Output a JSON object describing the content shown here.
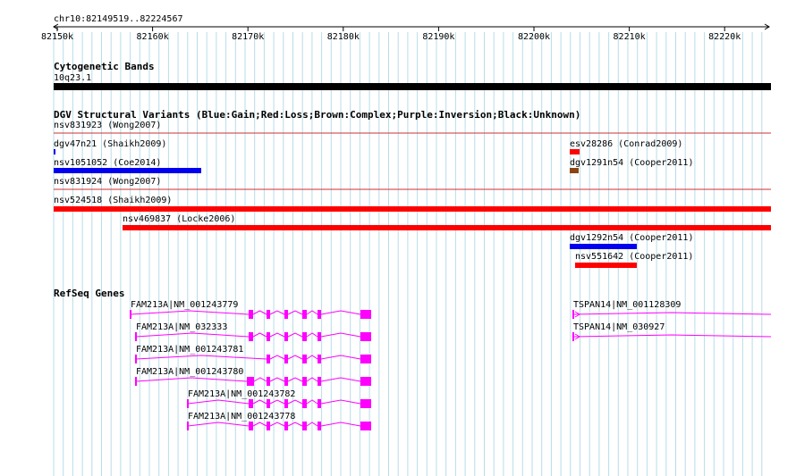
{
  "colors": {
    "grid": "#b8dcea",
    "gain": "#0000ee",
    "loss": "#ff0000",
    "complex": "#8b4513",
    "gene": "#ff00ff",
    "divider": "#cc3333",
    "ideogram": "#000000"
  },
  "ruler": {
    "label": "chr10:82149519..82224567",
    "ticks": [
      "82150k",
      "82160k",
      "82170k",
      "82180k",
      "82190k",
      "82200k",
      "82210k",
      "82220k"
    ],
    "arrow_icon": "double-arrow-icon"
  },
  "cytoband": {
    "title": "Cytogenetic Bands",
    "band": "10q23.1"
  },
  "dgv": {
    "title": "DGV Structural Variants (Blue:Gain;Red:Loss;Brown:Complex;Purple:Inversion;Black:Unknown)",
    "features": [
      {
        "label": "nsv831923 (Wong2007)"
      },
      {
        "label": "dgv47n21 (Shaikh2009)"
      },
      {
        "label": "nsv1051052 (Coe2014)"
      },
      {
        "label": "nsv831924 (Wong2007)"
      },
      {
        "label": "esv28286 (Conrad2009)"
      },
      {
        "label": "dgv1291n54 (Cooper2011)"
      },
      {
        "label": "nsv524518 (Shaikh2009)"
      },
      {
        "label": "nsv469837 (Locke2006)"
      },
      {
        "label": "dgv1292n54 (Cooper2011)"
      },
      {
        "label": "nsv551642 (Cooper2011)"
      }
    ]
  },
  "refseq": {
    "title": "RefSeq Genes",
    "transcripts": [
      {
        "label": "FAM213A|NM_001243779"
      },
      {
        "label": "FAM213A|NM_032333"
      },
      {
        "label": "FAM213A|NM_001243781"
      },
      {
        "label": "FAM213A|NM_001243780"
      },
      {
        "label": "FAM213A|NM_001243782"
      },
      {
        "label": "FAM213A|NM_001243778"
      },
      {
        "label": "TSPAN14|NM_001128309"
      },
      {
        "label": "TSPAN14|NM_030927"
      }
    ]
  }
}
